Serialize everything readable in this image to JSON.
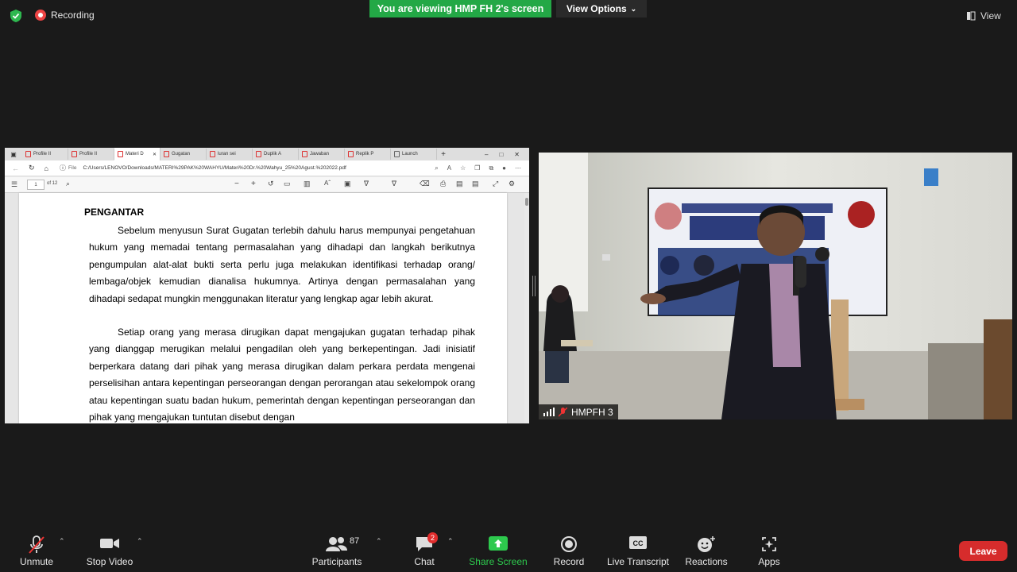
{
  "top_bar": {
    "recording_label": "Recording",
    "banner_text": "You are viewing HMP FH 2's screen",
    "view_options_label": "View Options",
    "view_label": "View"
  },
  "shared_screen": {
    "tabs": [
      "Profile II",
      "Profile II",
      "Materi D",
      "Gugatan",
      "luran sei",
      "Duplik A",
      "Jawaban",
      "Replik P",
      "Launch"
    ],
    "address": "C:/Users/LENOVO/Downloads/MATERI%29PAK%20WAHYU/Materi%20Dr.%20Wahyu_25%20Agust.%202022.pdf",
    "file_label": "File",
    "page_current": "1",
    "page_total": "of 12",
    "document": {
      "heading": "PENGANTAR",
      "paragraph1": "Sebelum menyusun Surat Gugatan terlebih dahulu harus mempunyai pengetahuan hukum yang memadai tentang permasalahan yang dihadapi dan langkah berikutnya pengumpulan alat-alat bukti serta perlu juga melakukan identifikasi terhadap orang/ lembaga/objek kemudian dianalisa hukumnya. Artinya dengan permasalahan yang dihadapi sedapat mungkin menggunakan literatur yang lengkap agar lebih akurat.",
      "paragraph2": "Setiap orang yang merasa dirugikan dapat mengajukan gugatan terhadap pihak yang dianggap merugikan melalui pengadilan oleh yang berkepentingan. Jadi inisiatif berperkara datang dari pihak yang merasa dirugikan dalam perkara perdata mengenai perselisihan antara kepentingan perseorangan dengan perorangan atau sekelompok orang atau kepentingan suatu badan hukum, pemerintah dengan kepentingan perseorangan dan pihak yang mengajukan tuntutan disebut dengan"
    }
  },
  "camera": {
    "participant_name": "HMPFH 3",
    "banner_title": "YOUTH CAREER COURSE WORKSHOP",
    "banner_line1": "\"MELATIH KEMAHIRAN ... HUKUM DALAM",
    "banner_line2": "MEMBUAT SURAT GUGA... AN NEGERI\""
  },
  "toolbar": {
    "unmute": "Unmute",
    "stop_video": "Stop Video",
    "participants": "Participants",
    "participants_count": "87",
    "chat": "Chat",
    "chat_badge": "2",
    "share_screen": "Share Screen",
    "record": "Record",
    "live_transcript": "Live Transcript",
    "reactions": "Reactions",
    "apps": "Apps",
    "leave": "Leave"
  },
  "colors": {
    "banner_green": "#23a846",
    "share_green": "#2dc94d",
    "leave_red": "#d62c2c",
    "recording_red": "#e44444"
  }
}
